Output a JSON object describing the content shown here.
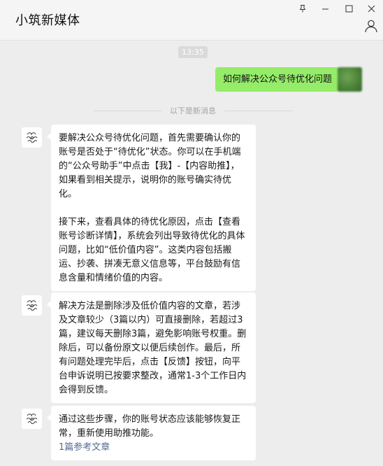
{
  "window": {
    "title": "小筑新媒体",
    "controls": [
      "pin-icon",
      "minimize-icon",
      "maximize-icon",
      "close-icon"
    ]
  },
  "chat": {
    "timestamp": "13:35",
    "user_message": "如何解决公众号待优化问题",
    "divider_text": "以下是新消息",
    "bot_messages": [
      {
        "paragraphs": [
          "要解决公众号待优化问题，首先需要确认你的账号是否处于“待优化”状态。你可以在手机端的“公众号助手”中点击【我】-【内容助推】，如果看到相关提示，说明你的账号确实待优化。",
          "接下来，查看具体的待优化原因，点击【查看账号诊断详情】，系统会列出导致待优化的具体问题，比如“低价值内容”。这类内容包括搬运、抄袭、拼凑无意义信息等，平台鼓励有信息含量和情绪价值的内容。"
        ]
      },
      {
        "paragraphs": [
          "解决方法是删除涉及低价值内容的文章，若涉及文章较少（3篇以内）可直接删除，若超过3篇，建议每天删除3篇，避免影响账号权重。删除后，可以备份原文以便后续创作。最后，所有问题处理完毕后，点击【反馈】按钮，向平台申诉说明已按要求整改，通常1-3个工作日内会得到反馈。"
        ]
      },
      {
        "paragraphs": [
          "通过这些步骤，你的账号状态应该能够恢复正常，重新使用助推功能。"
        ],
        "link": "1篇参考文章"
      }
    ]
  },
  "colors": {
    "user_bubble": "#95ec69",
    "bot_bubble": "#ffffff",
    "background": "#ededed",
    "link": "#576b95"
  }
}
